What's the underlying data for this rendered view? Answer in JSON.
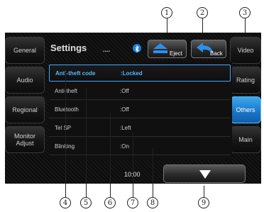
{
  "header": {
    "title": "Settings",
    "dots": "....",
    "bluetooth_icon": "bluetooth-icon"
  },
  "buttons": {
    "eject": "Eject",
    "back": "Back"
  },
  "left_tabs": [
    {
      "label": "General"
    },
    {
      "label": "Audio"
    },
    {
      "label": "Regional"
    },
    {
      "label": "Monitor Adjust"
    }
  ],
  "right_tabs": [
    {
      "label": "Video"
    },
    {
      "label": "Rating"
    },
    {
      "label": "Others"
    },
    {
      "label": "Main"
    }
  ],
  "settings": [
    {
      "key": "Anti-theft code",
      "value": ":Locked"
    },
    {
      "key": "Anti-theft",
      "value": ":Off"
    },
    {
      "key": "Bluetooth",
      "value": ":Off"
    },
    {
      "key": "Tel SP",
      "value": ":Left"
    },
    {
      "key": "Blinking",
      "value": ":On"
    }
  ],
  "clock": "10:00",
  "down_icon": "down-arrow-icon",
  "callouts": [
    "1",
    "2",
    "3",
    "4",
    "5",
    "6",
    "7",
    "8",
    "9"
  ],
  "colors": {
    "accent": "#1a73c6",
    "selected_text": "#53b8ff",
    "background": "#0a0a0a"
  }
}
